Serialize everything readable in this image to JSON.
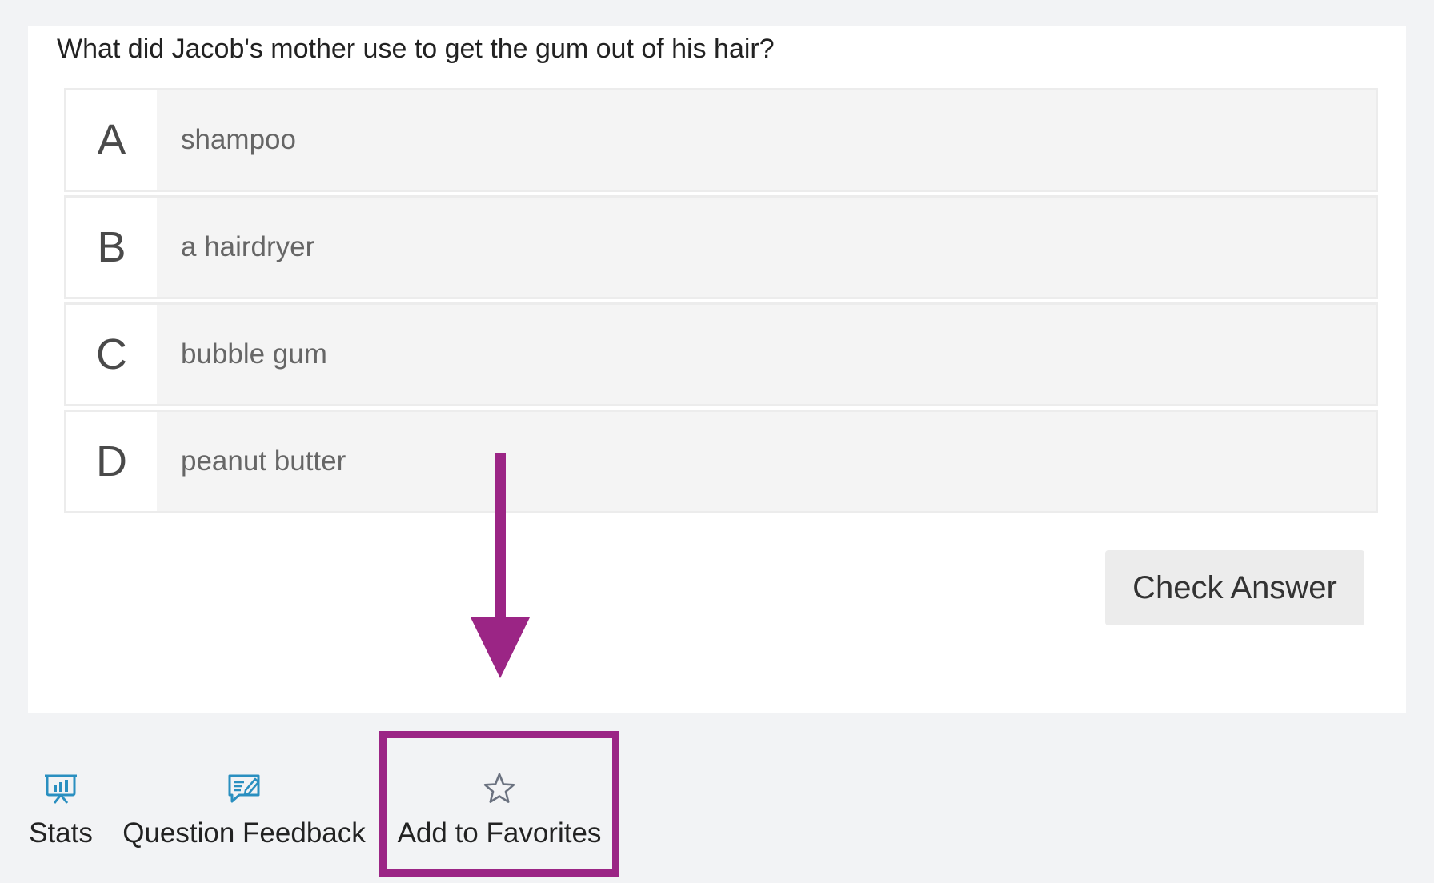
{
  "question": {
    "text": "What did Jacob's mother use to get the gum out of his hair?"
  },
  "options": [
    {
      "letter": "A",
      "text": "shampoo"
    },
    {
      "letter": "B",
      "text": "a hairdryer"
    },
    {
      "letter": "C",
      "text": "bubble gum"
    },
    {
      "letter": "D",
      "text": "peanut butter"
    }
  ],
  "actions": {
    "check_answer_label": "Check Answer"
  },
  "toolbar": {
    "stats_label": "Stats",
    "feedback_label": "Question Feedback",
    "favorites_label": "Add to Favorites"
  },
  "colors": {
    "annotation": "#9b2585",
    "toolbar_icon": "#2a8fc0",
    "star_icon": "#6b7280"
  },
  "icons": {
    "stats": "presentation-chart-icon",
    "feedback": "chat-edit-icon",
    "favorites": "star-outline-icon"
  }
}
